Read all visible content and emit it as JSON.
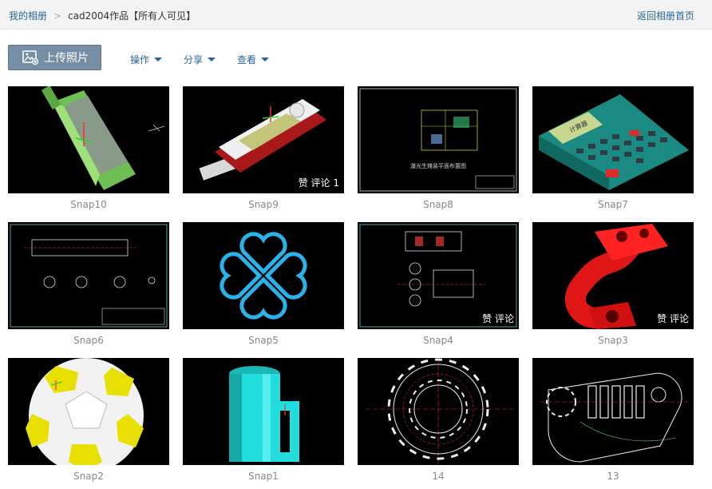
{
  "breadcrumb": {
    "root": "我的相册",
    "current": "cad2004作品【所有人可见】"
  },
  "back_link": "返回相册首页",
  "toolbar": {
    "upload_label": "上传照片",
    "menus": [
      "操作",
      "分享",
      "查看"
    ]
  },
  "photos": [
    {
      "caption": "Snap10",
      "badge": ""
    },
    {
      "caption": "Snap9",
      "badge": "赞  评论 1"
    },
    {
      "caption": "Snap8",
      "badge": ""
    },
    {
      "caption": "Snap7",
      "badge": ""
    },
    {
      "caption": "Snap6",
      "badge": ""
    },
    {
      "caption": "Snap5",
      "badge": ""
    },
    {
      "caption": "Snap4",
      "badge": "赞  评论"
    },
    {
      "caption": "Snap3",
      "badge": "赞  评论"
    },
    {
      "caption": "Snap2",
      "badge": ""
    },
    {
      "caption": "Snap1",
      "badge": ""
    },
    {
      "caption": "14",
      "badge": ""
    },
    {
      "caption": "13",
      "badge": ""
    }
  ],
  "thumb_text": {
    "snap8_title": "瀑光生摊装平面布置图",
    "snap7_display": "计算器"
  },
  "colors": {
    "link": "#2a6496",
    "upload_bg": "#778fa4",
    "caption": "#888888"
  }
}
